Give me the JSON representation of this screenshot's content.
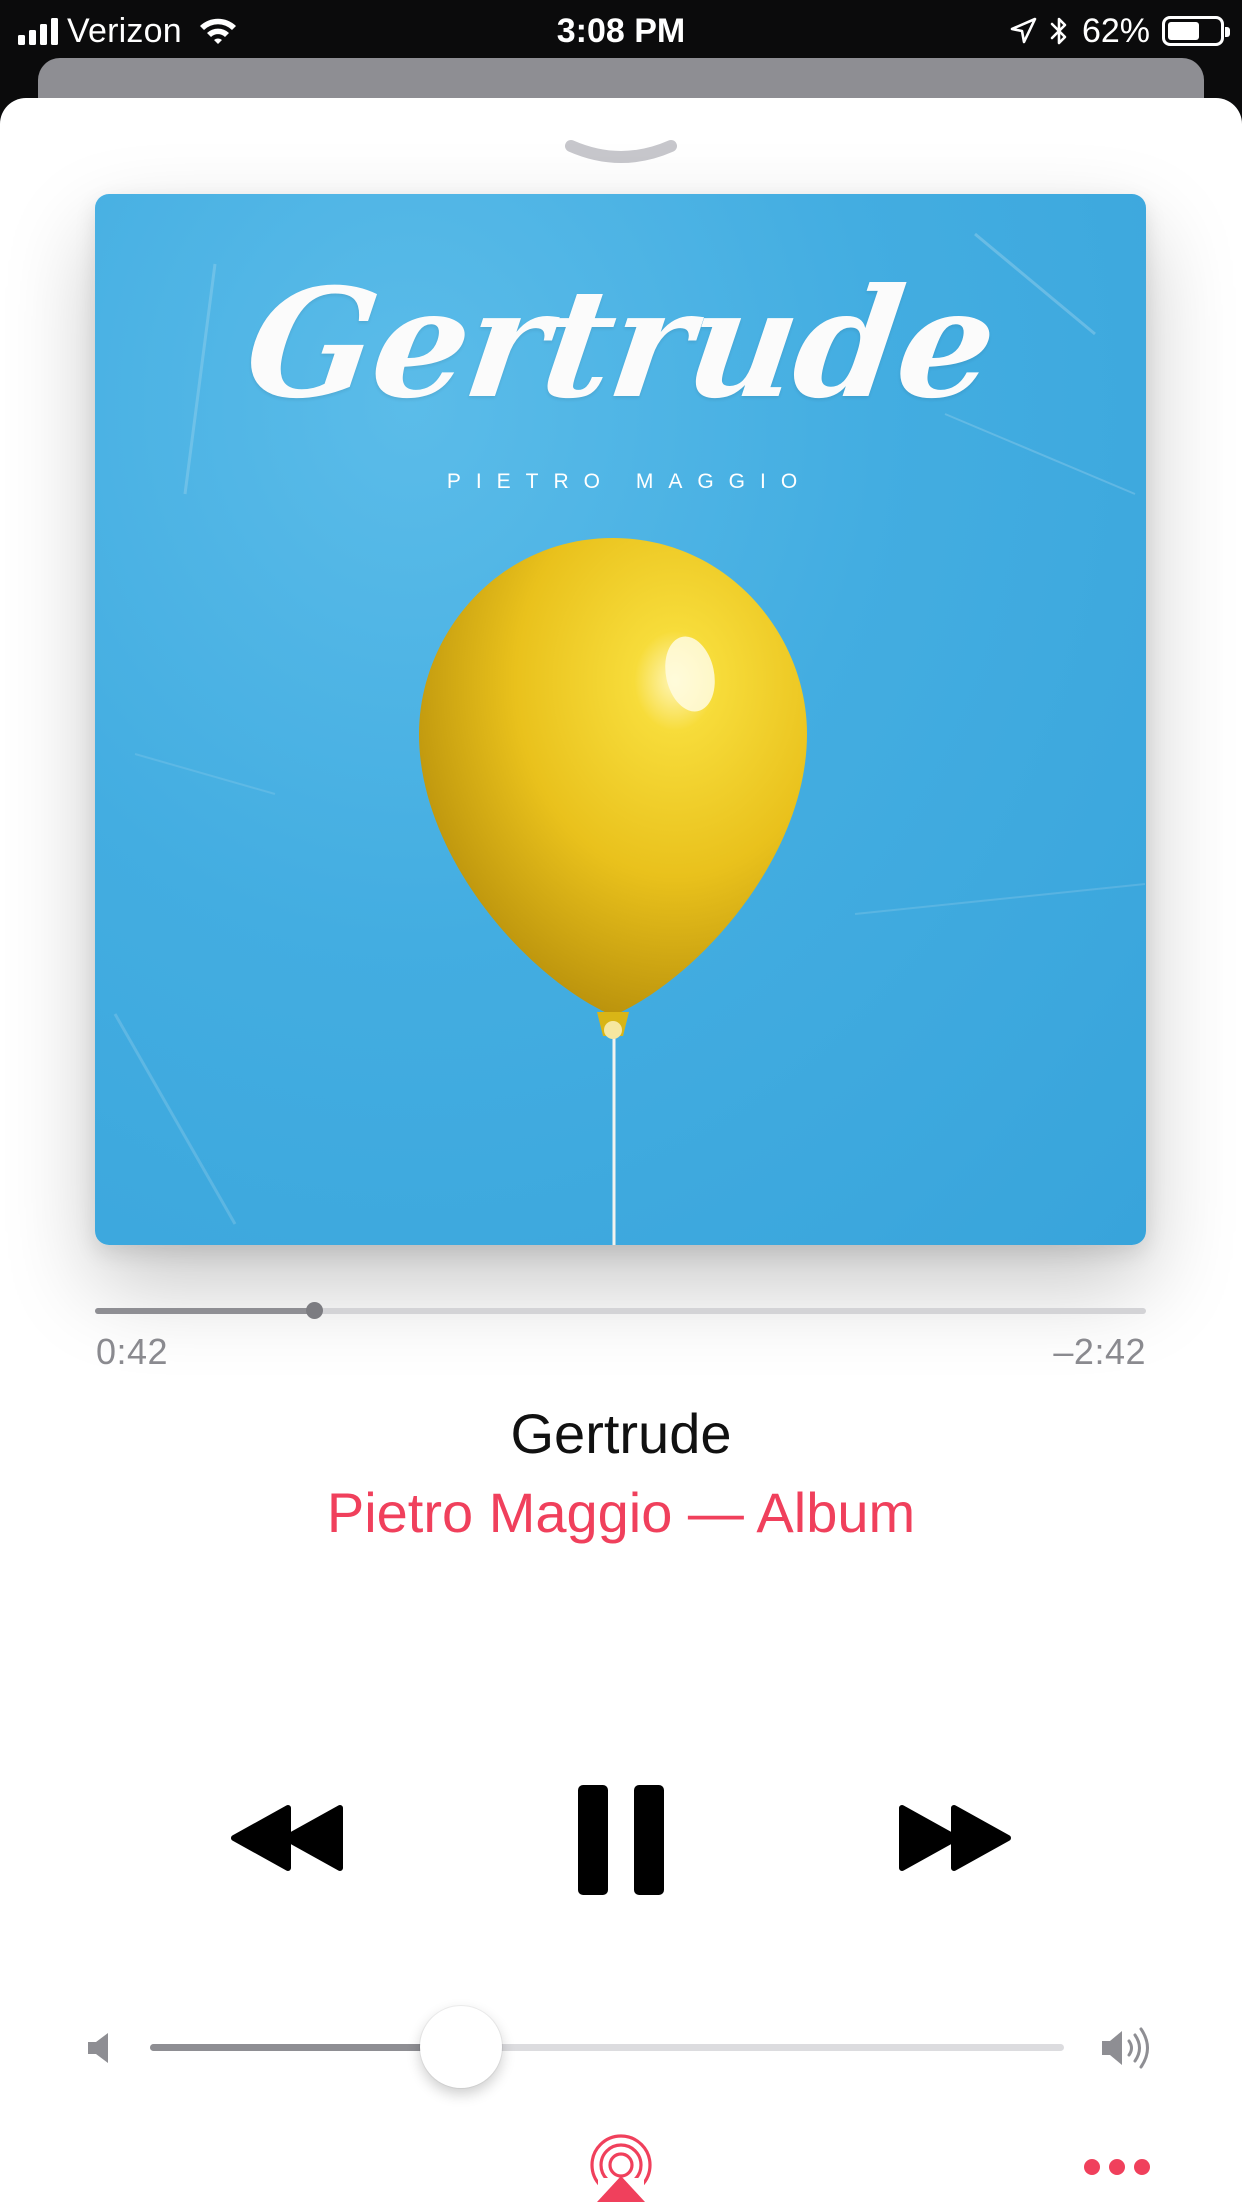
{
  "status_bar": {
    "carrier": "Verizon",
    "time": "3:08 PM",
    "battery_percent": "62%",
    "battery_level": 0.62,
    "icons": [
      "signal-icon",
      "wifi-icon",
      "location-arrow-icon",
      "bluetooth-icon",
      "battery-icon"
    ]
  },
  "artwork": {
    "title": "Gertrude",
    "artist": "PIETRO MAGGIO",
    "background_color": "#45b1e6",
    "balloon_color": "#f2cf24"
  },
  "playback": {
    "elapsed": "0:42",
    "remaining": "–2:42",
    "progress": 0.208
  },
  "song": {
    "title": "Gertrude",
    "subtitle": "Pietro Maggio — Album"
  },
  "controls": {
    "icons": [
      "rewind-icon",
      "pause-icon",
      "fast-forward-icon"
    ]
  },
  "volume": {
    "level": 0.34,
    "icons": [
      "volume-min-icon",
      "volume-max-icon"
    ]
  },
  "footer": {
    "icons": [
      "airplay-icon",
      "more-icon"
    ]
  },
  "colors": {
    "accent": "#f0405c",
    "scrubber_played": "#8e8e93",
    "scrubber_track": "#d3d3d6",
    "text_primary": "#111111",
    "text_secondary": "#8a8a8f"
  }
}
